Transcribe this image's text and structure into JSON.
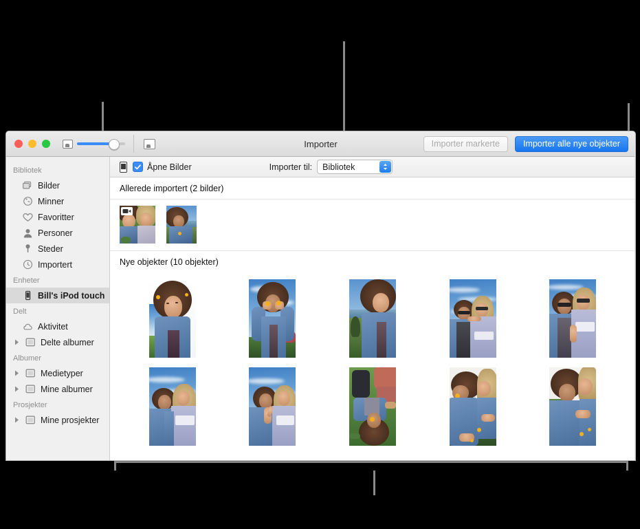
{
  "window": {
    "title": "Importer",
    "traffic_lights": [
      "close",
      "minimize",
      "zoom"
    ],
    "zoom_slider": {
      "value_percent": 72
    }
  },
  "toolbar": {
    "import_selected_label": "Importer markerte",
    "import_selected_enabled": false,
    "import_all_label": "Importer alle nye objekter",
    "import_all_color": "#1876ef"
  },
  "import_bar": {
    "device_icon": "iphone-icon",
    "open_photos_label": "Åpne Bilder",
    "open_photos_checked": true,
    "import_to_label": "Importer til:",
    "import_to_value": "Bibliotek",
    "import_to_options": [
      "Bibliotek"
    ]
  },
  "sidebar": {
    "groups": [
      {
        "header": "Bibliotek",
        "items": [
          {
            "label": "Bilder",
            "icon": "photos-icon",
            "disclosure": false,
            "selected": false
          },
          {
            "label": "Minner",
            "icon": "memories-icon",
            "disclosure": false,
            "selected": false
          },
          {
            "label": "Favoritter",
            "icon": "heart-icon",
            "disclosure": false,
            "selected": false
          },
          {
            "label": "Personer",
            "icon": "person-icon",
            "disclosure": false,
            "selected": false
          },
          {
            "label": "Steder",
            "icon": "pin-icon",
            "disclosure": false,
            "selected": false
          },
          {
            "label": "Importert",
            "icon": "clock-icon",
            "disclosure": false,
            "selected": false
          }
        ]
      },
      {
        "header": "Enheter",
        "items": [
          {
            "label": "Bill's iPod touch",
            "icon": "ipod-icon",
            "disclosure": false,
            "selected": true
          }
        ]
      },
      {
        "header": "Delt",
        "items": [
          {
            "label": "Aktivitet",
            "icon": "cloud-icon",
            "disclosure": false,
            "selected": false
          },
          {
            "label": "Delte albumer",
            "icon": "album-icon",
            "disclosure": true,
            "selected": false
          }
        ]
      },
      {
        "header": "Albumer",
        "items": [
          {
            "label": "Medietyper",
            "icon": "album-icon",
            "disclosure": true,
            "selected": false
          },
          {
            "label": "Mine albumer",
            "icon": "album-icon",
            "disclosure": true,
            "selected": false
          }
        ]
      },
      {
        "header": "Prosjekter",
        "items": [
          {
            "label": "Mine prosjekter",
            "icon": "album-icon",
            "disclosure": true,
            "selected": false
          }
        ]
      }
    ]
  },
  "content": {
    "already_imported": {
      "title": "Allerede importert (2 bilder)",
      "count": 2,
      "items": [
        {
          "name": "video-thumbnail-two-girls",
          "badge": "video-icon"
        },
        {
          "name": "photo-thumbnail-girl-at-coast",
          "badge": null
        }
      ]
    },
    "new_items": {
      "title": "Nye objekter (10 objekter)",
      "count": 10,
      "items": [
        {
          "name": "photo-girl-looking-up"
        },
        {
          "name": "photo-girl-flowers-over-eyes"
        },
        {
          "name": "photo-girl-smiling-coast"
        },
        {
          "name": "photo-two-girls-sunglasses-sky"
        },
        {
          "name": "photo-two-girls-sunglasses-smiling"
        },
        {
          "name": "photo-two-girls-park-sky"
        },
        {
          "name": "photo-two-girls-peace-sign"
        },
        {
          "name": "photo-girls-lying-grass-overhead"
        },
        {
          "name": "photo-girls-lying-grass-flower"
        },
        {
          "name": "photo-girls-lying-grass-close"
        }
      ]
    }
  },
  "callouts": [
    {
      "name": "callout-import-destination",
      "target": "import_to_popup"
    },
    {
      "name": "callout-import-all-button",
      "target": "import_all_button"
    },
    {
      "name": "callout-already-imported-section",
      "target": "already_imported"
    },
    {
      "name": "callout-new-items-grid",
      "target": "new_items"
    }
  ]
}
